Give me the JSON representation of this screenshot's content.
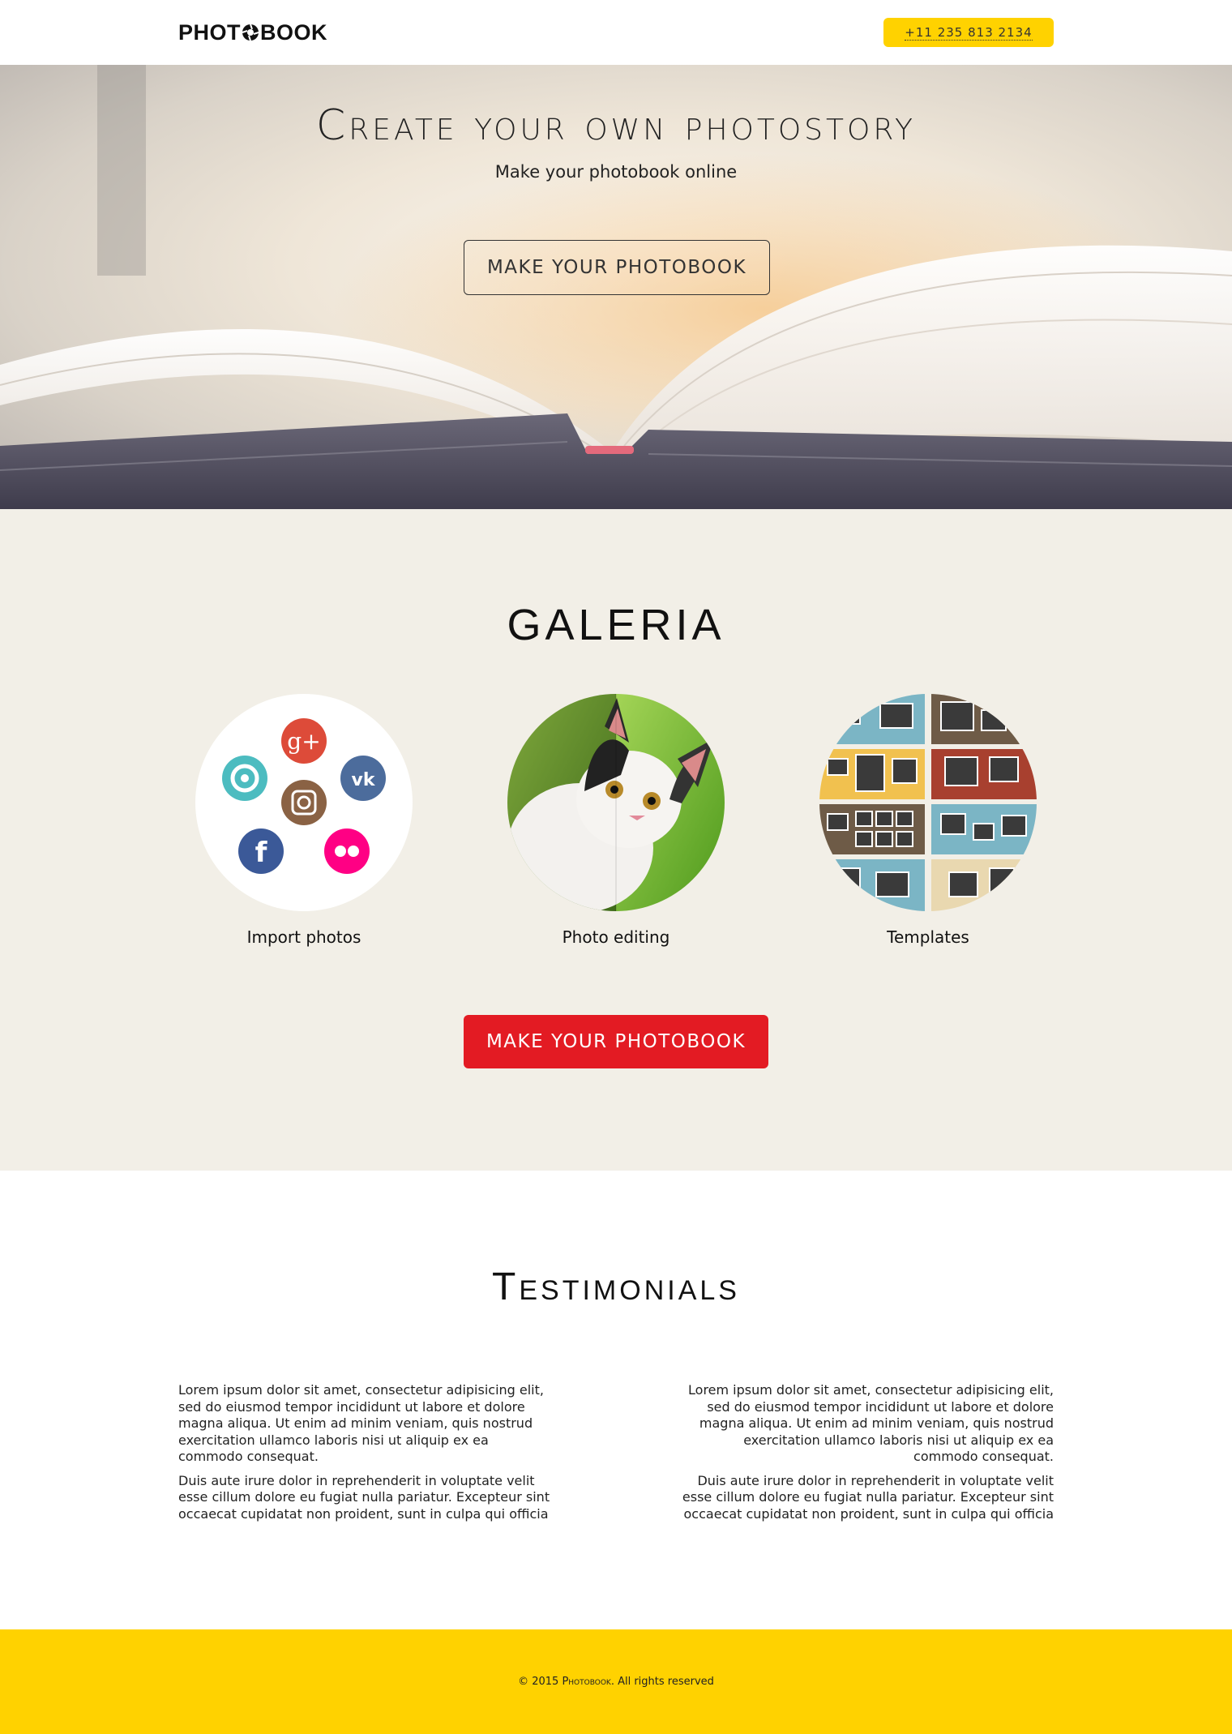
{
  "header": {
    "logo_text_left": "PHOT",
    "logo_text_right": "BOOK",
    "phone": "+11 235 813 2134"
  },
  "hero": {
    "title": "Create your own photostory",
    "subtitle": "Make your photobook online",
    "cta_label": "MAKE YOUR PHOTOBOOK"
  },
  "galeria": {
    "title": "GALERIA",
    "features": [
      {
        "label": "Import photos"
      },
      {
        "label": "Photo editing"
      },
      {
        "label": "Templates"
      }
    ],
    "cta_label": "MAKE YOUR PHOTOBOOK",
    "social_icons": [
      "google-plus-icon",
      "aperture-icon",
      "vk-icon",
      "instagram-icon",
      "facebook-icon",
      "flickr-icon"
    ]
  },
  "testimonials": {
    "title": "Testimonials",
    "items": [
      {
        "p1": "Lorem ipsum dolor sit amet, consectetur adipisicing elit, sed do eiusmod tempor incididunt ut labore et dolore magna aliqua. Ut enim ad minim veniam, quis nostrud exercitation ullamco laboris nisi ut aliquip ex ea commodo consequat.",
        "p2": "Duis aute irure dolor in reprehenderit in voluptate velit esse cillum dolore eu fugiat nulla pariatur. Excepteur sint occaecat cupidatat non proident, sunt in culpa qui officia"
      },
      {
        "p1": "Lorem ipsum dolor sit amet, consectetur adipisicing elit, sed do eiusmod tempor incididunt ut labore et dolore magna aliqua. Ut enim ad minim veniam, quis nostrud exercitation ullamco laboris nisi ut aliquip ex ea commodo consequat.",
        "p2": "Duis aute irure dolor in reprehenderit in voluptate velit esse cillum dolore eu fugiat nulla pariatur. Excepteur sint occaecat cupidatat non proident, sunt in culpa qui officia"
      }
    ]
  },
  "footer": {
    "copy_prefix": "© 2015 ",
    "brand": "Photobook",
    "copy_suffix": ". All rights reserved"
  },
  "colors": {
    "accent_yellow": "#ffd200",
    "accent_red": "#e31b23",
    "galeria_bg": "#f2efe7"
  }
}
